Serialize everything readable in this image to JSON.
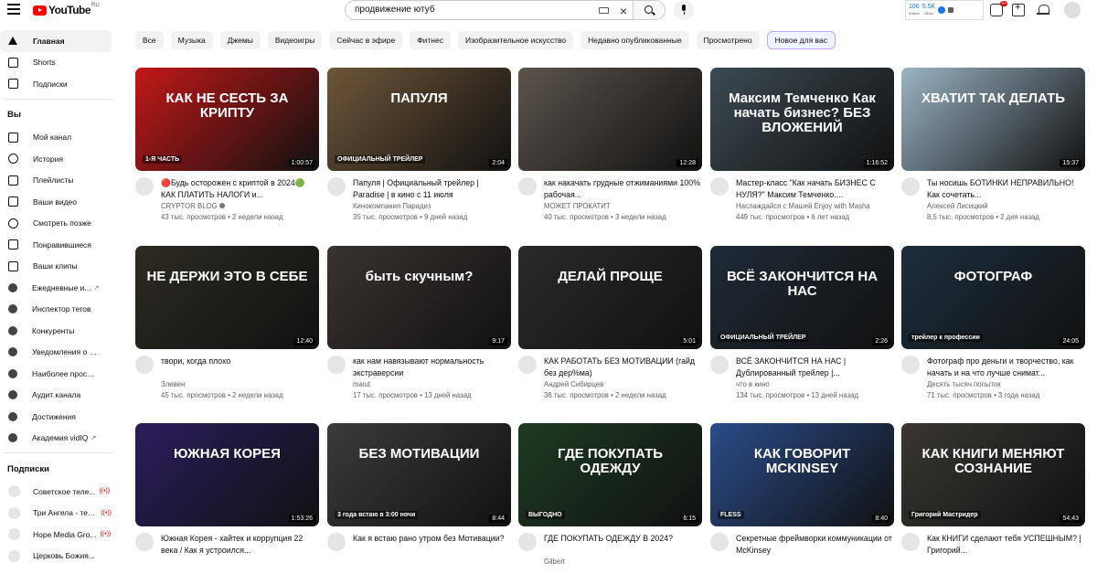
{
  "header": {
    "logo_text": "YouTube",
    "logo_region": "RU",
    "search_value": "продвижение ютуб",
    "ext_stats": [
      {
        "value": "106",
        "unit": "50мин"
      },
      {
        "value": "5.5K",
        "unit": "48час"
      }
    ],
    "notification_badge": "9+"
  },
  "sidebar": {
    "main": [
      {
        "label": "Главная",
        "icon": "home-icon",
        "active": true
      },
      {
        "label": "Shorts",
        "icon": "shorts-icon"
      },
      {
        "label": "Подписки",
        "icon": "subscriptions-icon"
      }
    ],
    "you_title": "Вы",
    "you": [
      {
        "label": "Мой канал",
        "icon": "channel-icon"
      },
      {
        "label": "История",
        "icon": "history-icon"
      },
      {
        "label": "Плейлисты",
        "icon": "playlists-icon"
      },
      {
        "label": "Ваши видео",
        "icon": "your-videos-icon"
      },
      {
        "label": "Смотреть позже",
        "icon": "watch-later-icon"
      },
      {
        "label": "Понравившиеся",
        "icon": "liked-icon"
      },
      {
        "label": "Ваши клипы",
        "icon": "clips-icon"
      },
      {
        "label": "Ежедневные и...",
        "icon": "vidiq-icon",
        "ext": true
      },
      {
        "label": "Инспектор тегов",
        "icon": "vidiq-icon"
      },
      {
        "label": "Конкуренты",
        "icon": "vidiq-icon"
      },
      {
        "label": "Уведомления о т...",
        "icon": "vidiq-icon"
      },
      {
        "label": "Наиболее просма...",
        "icon": "vidiq-icon"
      },
      {
        "label": "Аудит канала",
        "icon": "vidiq-icon"
      },
      {
        "label": "Достижения",
        "icon": "vidiq-icon"
      },
      {
        "label": "Академия vidIQ",
        "icon": "vidiq-icon",
        "ext": true
      }
    ],
    "subs_title": "Подписки",
    "subs": [
      {
        "label": "Советское теле..."
      },
      {
        "label": "Три Ангела - тел..."
      },
      {
        "label": "Hope Media Gro..."
      },
      {
        "label": "Церковь Божия..."
      }
    ]
  },
  "chips": [
    "Все",
    "Музыка",
    "Джемы",
    "Видеоигры",
    "Сейчас в эфире",
    "Фитнес",
    "Изобразительное искусство",
    "Недавно опубликованные",
    "Просмотрено",
    "Новое для вас"
  ],
  "videos": [
    {
      "title": "🔴Будь осторожен с криптой в 2024🟢КАК ПЛАТИТЬ НАЛОГИ и...",
      "channel": "CRYPTOR BLOG",
      "verified": true,
      "stats": "43 тыс. просмотров • 2 недели назад",
      "duration": "1:00:57",
      "thumb_text": "КАК НЕ СЕСТЬ ЗА КРИПТУ",
      "thumb_sub": "1-Я ЧАСТЬ",
      "bg": "#c21818"
    },
    {
      "title": "Папуля | Официальный трейлер | Paradise | в кино с 11 июля",
      "channel": "Кинокомпания Парадиз",
      "stats": "35 тыс. просмотров • 9 дней назад",
      "duration": "2:04",
      "thumb_text": "ПАПУЛЯ",
      "thumb_sub": "ОФИЦИАЛЬНЫЙ ТРЕЙЛЕР",
      "bg": "#6d5638"
    },
    {
      "title": "как накачать грудные отжиманиями 100% рабочая...",
      "channel": "МОЖЕТ ПРОКАТИТ",
      "stats": "40 тыс. просмотров • 3 недели назад",
      "duration": "12:28",
      "thumb_text": "",
      "bg": "#5c534c"
    },
    {
      "title": "Мастер-класс \"Как начать БИЗНЕС С НУЛЯ?\" Максим Темченко....",
      "channel": "Наслаждайся с Машей Enjoy with Masha",
      "stats": "449 тыс. просмотров • 6 лет назад",
      "duration": "1:16:52",
      "thumb_text": "Максим Темченко Как начать бизнес? БЕЗ ВЛОЖЕНИЙ",
      "bg": "#3c4a52"
    },
    {
      "title": "Ты носишь БОТИНКИ НЕПРАВИЛЬНО! Как сочетать...",
      "channel": "Алексей Лисицкий",
      "stats": "8,5 тыс. просмотров • 2 дня назад",
      "duration": "15:37",
      "thumb_text": "ХВАТИТ ТАК ДЕЛАТЬ",
      "bg": "#9bb4c4"
    },
    {
      "title": "твори, когда плохо",
      "channel": "Злевен",
      "stats": "45 тыс. просмотров • 2 недели назад",
      "duration": "12:40",
      "thumb_text": "НЕ ДЕРЖИ ЭТО В СЕБЕ",
      "bg": "#2d2a22"
    },
    {
      "title": "как нам навязывают нормальность экстраверсии",
      "channel": "maiut",
      "stats": "17 тыс. просмотров • 13 дней назад",
      "duration": "9:17",
      "thumb_text": "быть скучным?",
      "bg": "#3a3330"
    },
    {
      "title": "КАК РАБОТАТЬ БЕЗ МОТИВАЦИИ (гайд без дер%ма)",
      "channel": "Андрей Сибирцев",
      "stats": "36 тыс. просмотров • 2 недели назад",
      "duration": "5:01",
      "thumb_text": "ДЕЛАЙ ПРОЩЕ",
      "bg": "#2a2a2a"
    },
    {
      "title": "ВСЁ ЗАКОНЧИТСЯ НА НАС | Дублированный трейлер |...",
      "channel": "что в кино",
      "stats": "134 тыс. просмотров • 13 дней назад",
      "duration": "2:26",
      "thumb_text": "ВСЁ ЗАКОНЧИТСЯ НА НАС",
      "thumb_sub": "ОФИЦИАЛЬНЫЙ ТРЕЙЛЕР",
      "bg": "#1f2a36"
    },
    {
      "title": "Фотограф про деньги и творчество, как начать и на что лучше снимат...",
      "channel": "Десять тысяч попыток",
      "stats": "71 тыс. просмотров • 3 года назад",
      "duration": "24:05",
      "thumb_text": "ФОТОГРАФ",
      "thumb_sub": "трейлер к профессии",
      "bg": "#1c2e3c"
    },
    {
      "title": "Южная Корея - хайтек и коррупция 22 века / Как я устроился...",
      "channel": "",
      "stats": "",
      "duration": "1:53:26",
      "thumb_text": "ЮЖНАЯ КОРЕЯ",
      "bg": "#2b1d5c"
    },
    {
      "title": "Как я встаю рано утром без Мотивации?",
      "channel": "",
      "stats": "",
      "duration": "8:44",
      "thumb_text": "БЕЗ МОТИВАЦИИ",
      "thumb_sub": "3 года встаю в 3:00 ночи",
      "bg": "#3b3b3b"
    },
    {
      "title": "ГДЕ ПОКУПАТЬ ОДЕЖДУ В 2024?",
      "channel": "Gilbert",
      "stats": "",
      "duration": "6:15",
      "thumb_text": "ГДЕ ПОКУПАТЬ ОДЕЖДУ",
      "thumb_sub": "ВЫГОДНО",
      "bg": "#1d3b22"
    },
    {
      "title": "Секретные фреймворки коммуникации от McKinsey",
      "channel": "",
      "stats": "",
      "duration": "8:40",
      "thumb_text": "КАК ГОВОРИТ MCKINSEY",
      "thumb_sub": "FLESS",
      "bg": "#2a4c88"
    },
    {
      "title": "Как КНИГИ сделают тебя УСПЕШНЫМ? | Григорий...",
      "channel": "",
      "stats": "",
      "duration": "54:43",
      "thumb_text": "КАК КНИГИ МЕНЯЮТ СОЗНАНИЕ",
      "thumb_sub": "Григорий Мастридер",
      "bg": "#3a3732"
    }
  ]
}
